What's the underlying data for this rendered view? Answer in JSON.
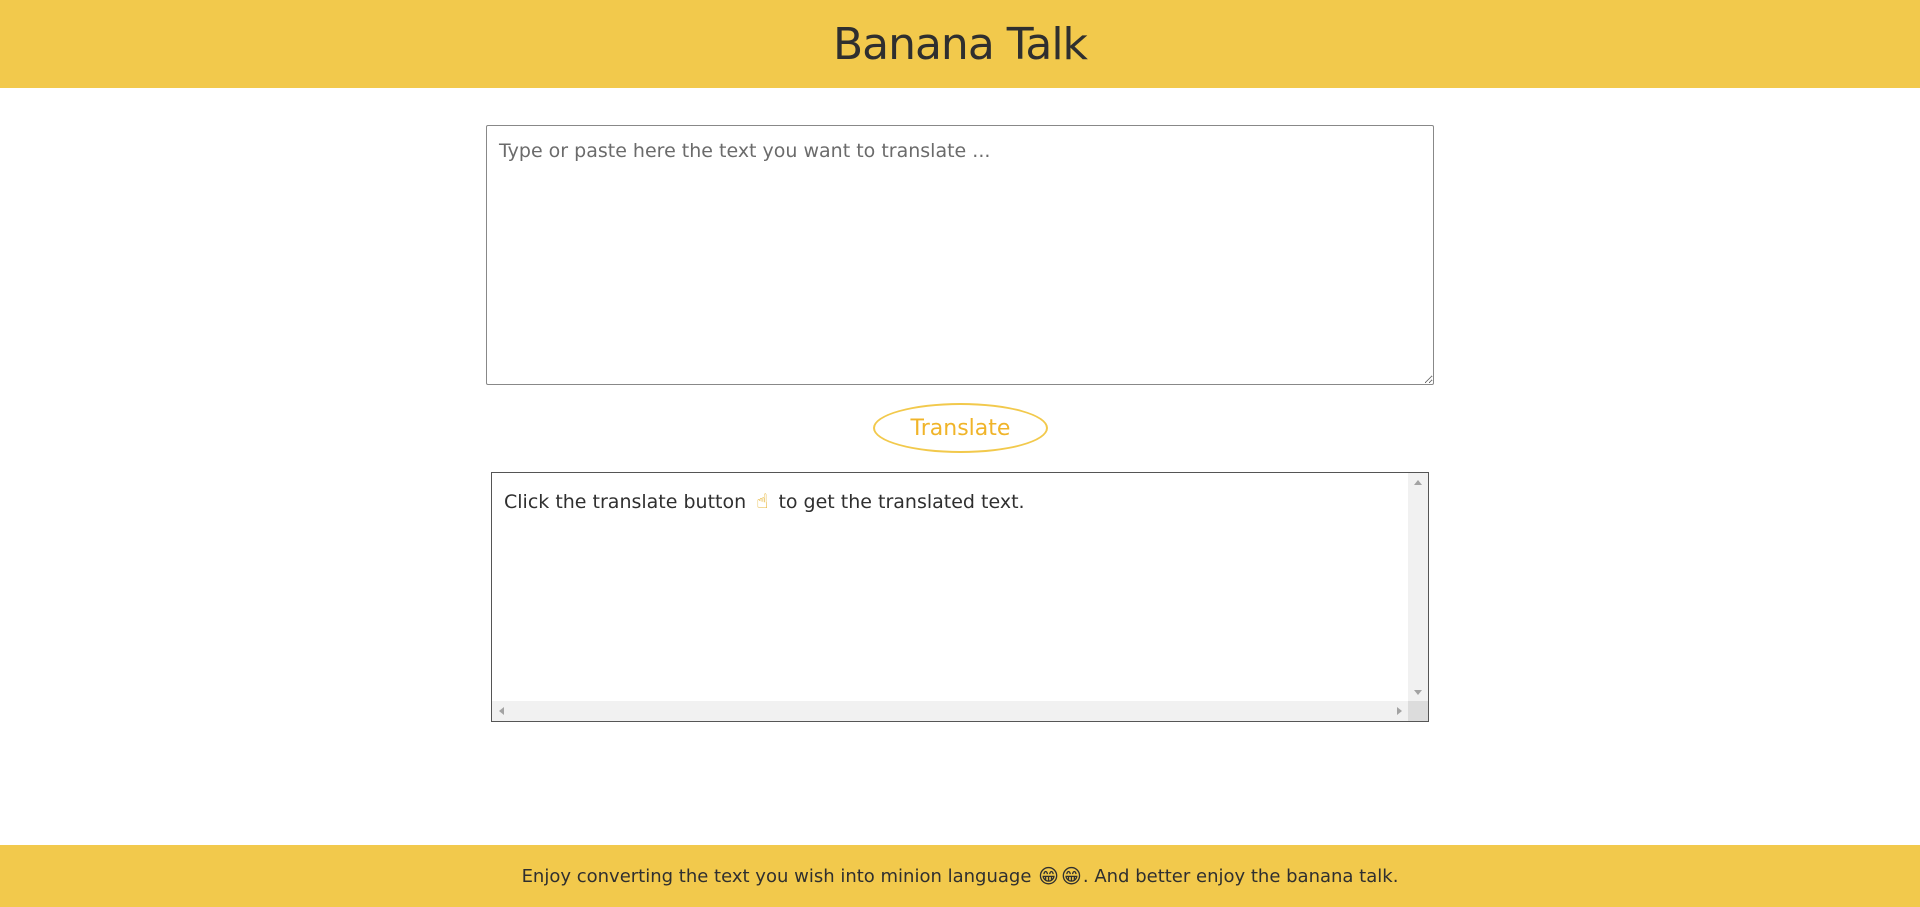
{
  "header": {
    "title": "Banana Talk"
  },
  "input": {
    "placeholder": "Type or paste here the text you want to translate ...",
    "value": ""
  },
  "translate_button": {
    "label": "Translate"
  },
  "output": {
    "text_before": "Click the translate button",
    "icon": "pointing-hand-icon",
    "text_after": "to get the translated text."
  },
  "footer": {
    "text_before": "Enjoy converting the text you wish into minion language",
    "icons": [
      "grinning-face-icon",
      "grinning-face-icon"
    ],
    "text_after": ". And better enjoy the banana talk."
  },
  "colors": {
    "accent": "#f2c94c",
    "button_text": "#f0b429",
    "text": "#2f2f2f"
  }
}
